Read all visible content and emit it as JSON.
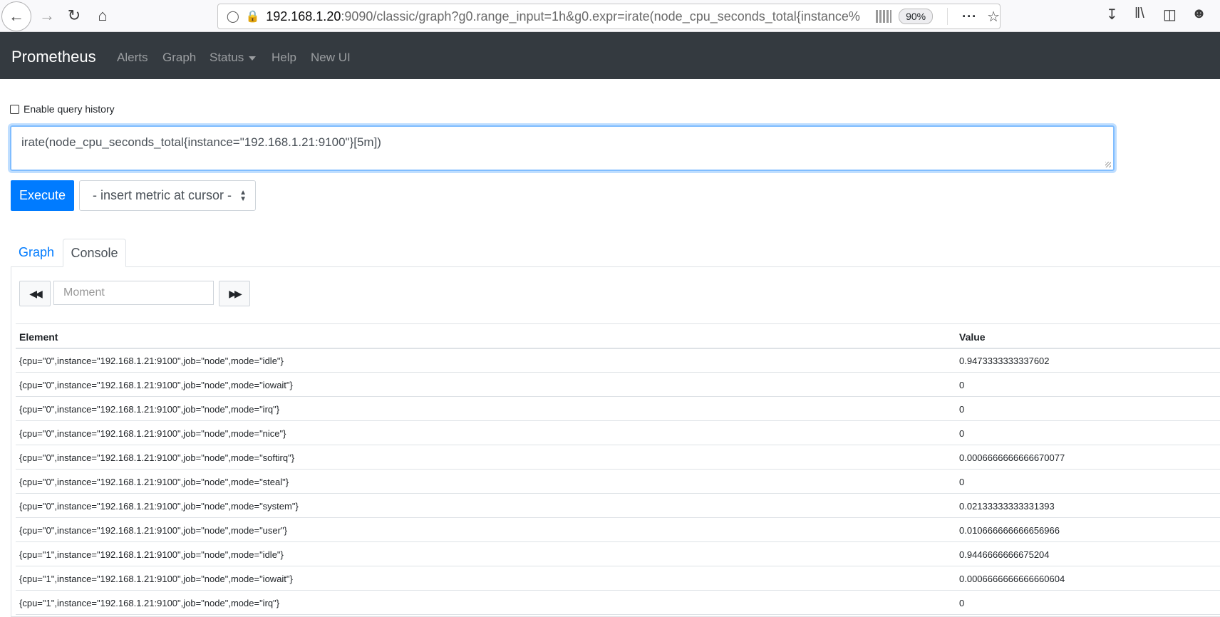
{
  "browser": {
    "url_host": "192.168.1.20",
    "url_rest": ":9090/classic/graph?g0.range_input=1h&g0.expr=irate(node_cpu_seconds_total{instance%",
    "zoom": "90%"
  },
  "navbar": {
    "brand": "Prometheus",
    "links": [
      "Alerts",
      "Graph",
      "Status",
      "Help",
      "New UI"
    ]
  },
  "query": {
    "history_label": "Enable query history",
    "expression": "irate(node_cpu_seconds_total{instance=\"192.168.1.21:9100\"}[5m])",
    "execute_label": "Execute",
    "metric_select": "- insert metric at cursor -"
  },
  "tabs": [
    "Graph",
    "Console"
  ],
  "console": {
    "moment_placeholder": "Moment",
    "columns": [
      "Element",
      "Value"
    ],
    "rows": [
      {
        "element": "{cpu=\"0\",instance=\"192.168.1.21:9100\",job=\"node\",mode=\"idle\"}",
        "value": "0.9473333333337602"
      },
      {
        "element": "{cpu=\"0\",instance=\"192.168.1.21:9100\",job=\"node\",mode=\"iowait\"}",
        "value": "0"
      },
      {
        "element": "{cpu=\"0\",instance=\"192.168.1.21:9100\",job=\"node\",mode=\"irq\"}",
        "value": "0"
      },
      {
        "element": "{cpu=\"0\",instance=\"192.168.1.21:9100\",job=\"node\",mode=\"nice\"}",
        "value": "0"
      },
      {
        "element": "{cpu=\"0\",instance=\"192.168.1.21:9100\",job=\"node\",mode=\"softirq\"}",
        "value": "0.0006666666666670077"
      },
      {
        "element": "{cpu=\"0\",instance=\"192.168.1.21:9100\",job=\"node\",mode=\"steal\"}",
        "value": "0"
      },
      {
        "element": "{cpu=\"0\",instance=\"192.168.1.21:9100\",job=\"node\",mode=\"system\"}",
        "value": "0.02133333333331393"
      },
      {
        "element": "{cpu=\"0\",instance=\"192.168.1.21:9100\",job=\"node\",mode=\"user\"}",
        "value": "0.010666666666656966"
      },
      {
        "element": "{cpu=\"1\",instance=\"192.168.1.21:9100\",job=\"node\",mode=\"idle\"}",
        "value": "0.9446666666675204"
      },
      {
        "element": "{cpu=\"1\",instance=\"192.168.1.21:9100\",job=\"node\",mode=\"iowait\"}",
        "value": "0.0006666666666660604"
      },
      {
        "element": "{cpu=\"1\",instance=\"192.168.1.21:9100\",job=\"node\",mode=\"irq\"}",
        "value": "0"
      }
    ]
  }
}
